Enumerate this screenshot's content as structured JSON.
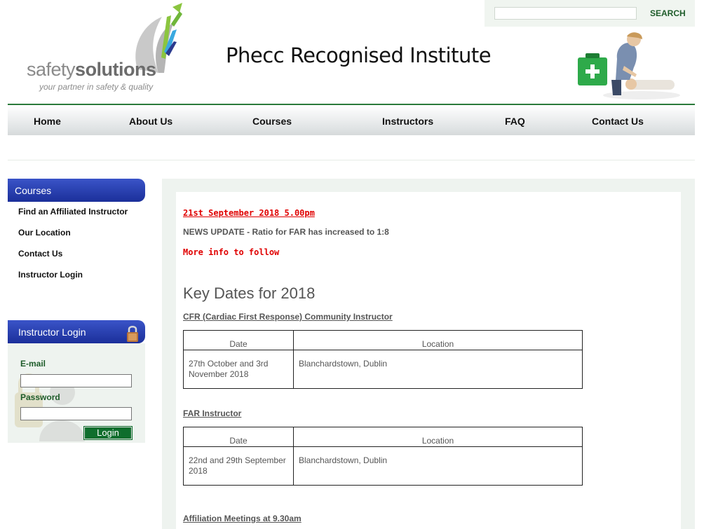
{
  "brand": {
    "logo_word_light": "safety",
    "logo_word_bold": "solutions",
    "tagline": "your partner in safety & quality",
    "bird_colors": [
      "#8bc53f",
      "#3aa9e0",
      "#2b3a8f",
      "#c8c8c8"
    ]
  },
  "header": {
    "title": "Phecc Recognised Institute",
    "search_placeholder": "",
    "search_label": "SEARCH"
  },
  "nav": {
    "items": [
      "Home",
      "About Us",
      "Courses",
      "Instructors",
      "FAQ",
      "Contact Us"
    ]
  },
  "sidebar": {
    "courses_heading": "Courses",
    "links": [
      "Find an Affiliated Instructor",
      "Our Location",
      "Contact Us",
      "Instructor Login"
    ],
    "login_heading": "Instructor Login",
    "email_label": "E-mail",
    "password_label": "Password",
    "login_button": "Login"
  },
  "content": {
    "date_line": "21st September 2018 5.00pm",
    "news": "NEWS UPDATE - Ratio for FAR has increased to 1:8",
    "more_info": "More info to follow",
    "key_dates_heading": "Key Dates for 2018",
    "sections": [
      {
        "title": "CFR (Cardiac First Response) Community Instructor",
        "col_date": "Date",
        "col_location": "Location",
        "date": "27th October and 3rd November 2018",
        "location": "Blanchardstown, Dublin"
      },
      {
        "title": "FAR Instructor",
        "col_date": "Date",
        "col_location": "Location",
        "date": "22nd and 29th September 2018",
        "location": "Blanchardstown, Dublin"
      }
    ],
    "affiliation_title": "Affiliation Meetings at 9.30am"
  },
  "colors": {
    "accent_green": "#1e5c2a",
    "nav_border": "#2b7a3b",
    "sidebar_blue": "#2a41b4",
    "alert_red": "#e00000"
  }
}
